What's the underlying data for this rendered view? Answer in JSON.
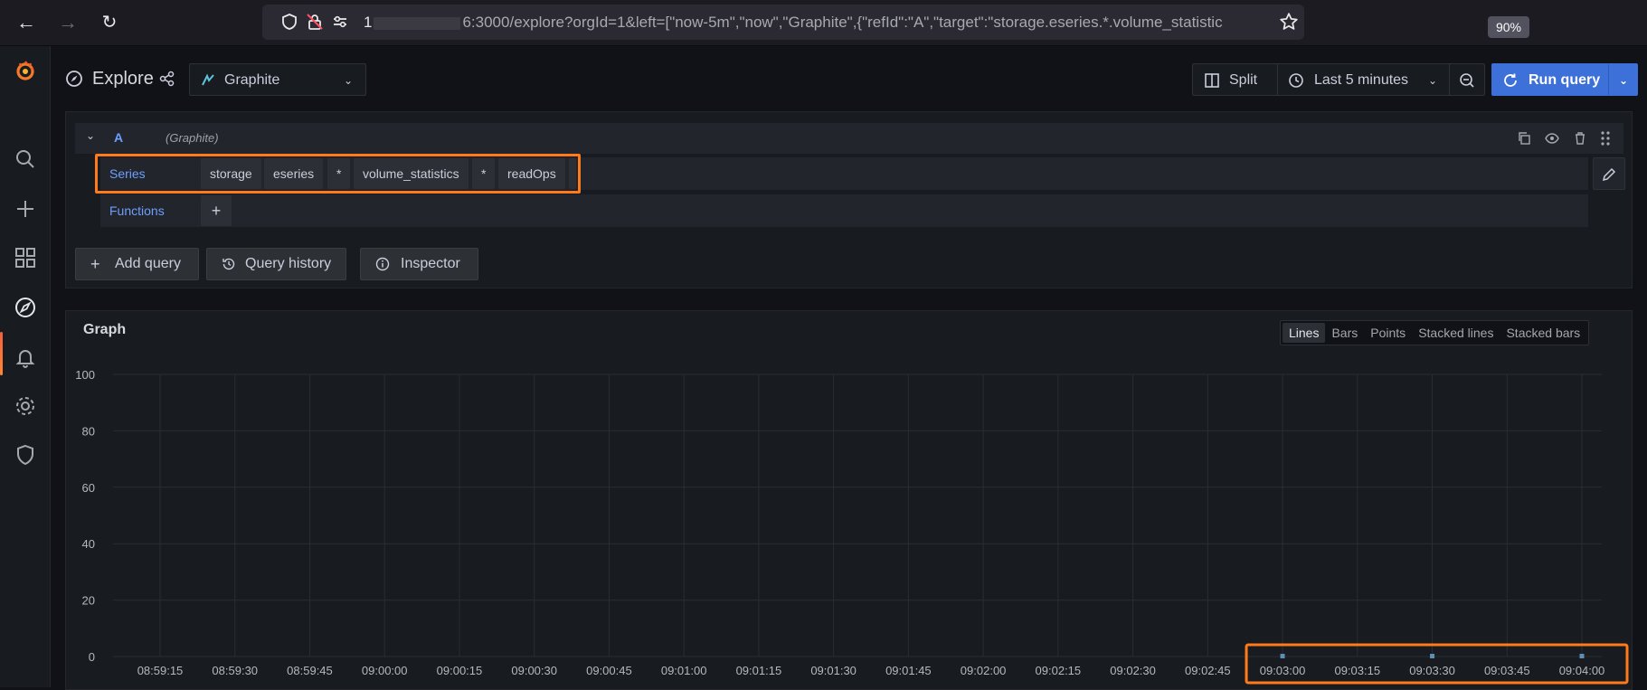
{
  "browser": {
    "url_prefix": "1",
    "url_rest": "6:3000/explore?orgId=1&left=[\"now-5m\",\"now\",\"Graphite\",{\"refId\":\"A\",\"target\":\"storage.eseries.*.volume_statistic",
    "zoom": "90%"
  },
  "toolbar": {
    "title": "Explore",
    "datasource": "Graphite",
    "split_label": "Split",
    "time_range": "Last 5 minutes",
    "run_label": "Run query"
  },
  "query": {
    "ref_id": "A",
    "ds_hint": "(Graphite)",
    "series_label": "Series",
    "series_segments": [
      "storage",
      "eseries",
      "*",
      "volume_statistics",
      "*",
      "readOps"
    ],
    "functions_label": "Functions",
    "add_function": "+",
    "add_query_label": "Add query",
    "history_label": "Query history",
    "inspector_label": "Inspector"
  },
  "graph": {
    "title": "Graph",
    "modes": [
      "Lines",
      "Bars",
      "Points",
      "Stacked lines",
      "Stacked bars"
    ],
    "selected_mode": "Lines"
  },
  "colors": {
    "accent": "#3d71d9",
    "highlight": "#ff7a1a",
    "series": "#73bf69"
  },
  "chart_data": {
    "type": "line",
    "title": "",
    "xlabel": "",
    "ylabel": "",
    "ylim": [
      0,
      100
    ],
    "yticks": [
      0,
      20,
      40,
      60,
      80,
      100
    ],
    "x_ticks": [
      "08:59:15",
      "08:59:30",
      "08:59:45",
      "09:00:00",
      "09:00:15",
      "09:00:30",
      "09:00:45",
      "09:01:00",
      "09:01:15",
      "09:01:30",
      "09:01:45",
      "09:02:00",
      "09:02:15",
      "09:02:30",
      "09:02:45",
      "09:03:00",
      "09:03:15",
      "09:03:30",
      "09:03:45",
      "09:04:00"
    ],
    "grid": true,
    "series": [
      {
        "x": [
          "09:03:00",
          "09:03:30",
          "09:04:00"
        ],
        "values": [
          0,
          0,
          0
        ]
      }
    ]
  }
}
